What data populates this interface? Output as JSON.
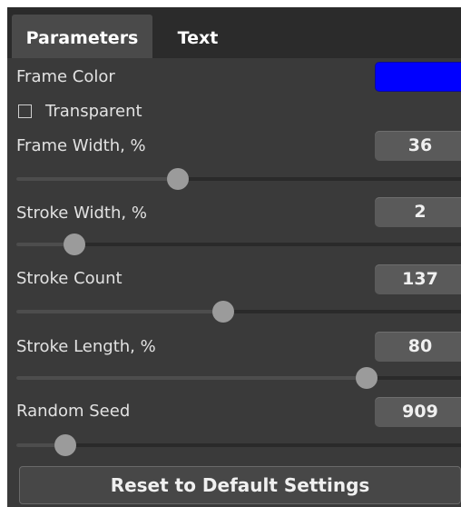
{
  "tabs": [
    {
      "label": "Parameters",
      "active": true
    },
    {
      "label": "Text",
      "active": false
    }
  ],
  "frame_color": {
    "label": "Frame Color",
    "value": "#0000ff"
  },
  "transparent": {
    "label": "Transparent",
    "checked": false
  },
  "sliders": [
    {
      "label": "Frame Width, %",
      "value": "36",
      "position": 0.36
    },
    {
      "label": "Stroke Width, %",
      "value": "2",
      "position": 0.13
    },
    {
      "label": "Stroke Count",
      "value": "137",
      "position": 0.46
    },
    {
      "label": "Stroke Length, %",
      "value": "80",
      "position": 0.78
    },
    {
      "label": "Random Seed",
      "value": "909",
      "position": 0.11
    }
  ],
  "reset_button": {
    "label": "Reset to Default Settings"
  },
  "colors": {
    "panel": "#3a3a3a",
    "tab_bar": "#2b2b2b",
    "active_tab": "#4a4a4a",
    "accent": "#0000ff"
  }
}
